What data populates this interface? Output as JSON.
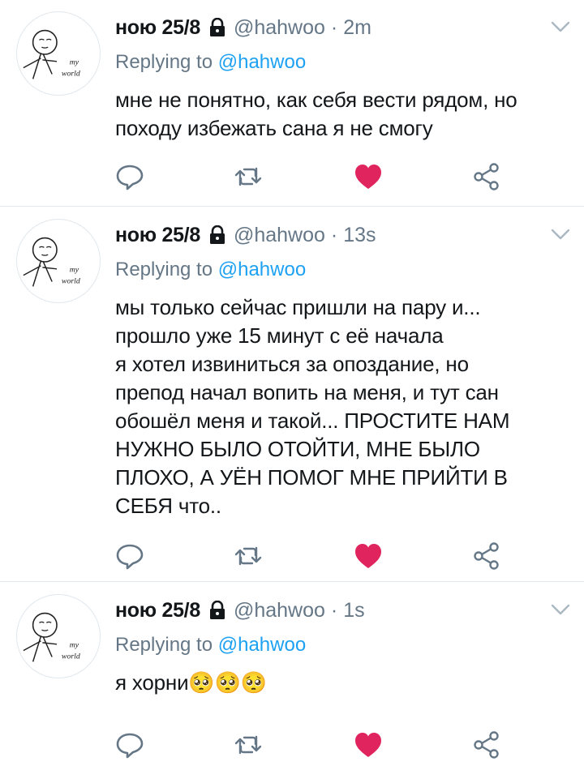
{
  "colors": {
    "text": "#14171a",
    "secondary": "#657786",
    "mention": "#1da1f2",
    "like": "#e0245e",
    "divider": "#e1e8ed"
  },
  "avatar": {
    "label_top": "my",
    "label_bottom": "world"
  },
  "tweets": [
    {
      "display_name": "ною 25/8",
      "handle": "@hahwoo",
      "dot": "·",
      "time": "2m",
      "replying_prefix": "Replying to ",
      "replying_mention": "@hahwoo",
      "text": "мне не понятно, как себя вести рядом, но\nпоходу избежать сана я не смогу",
      "icons": [
        "lock-icon",
        "chevron-down-icon",
        "reply-icon",
        "retweet-icon",
        "heart-icon",
        "share-icon"
      ],
      "liked": true
    },
    {
      "display_name": "ною 25/8",
      "handle": "@hahwoo",
      "dot": "·",
      "time": "13s",
      "replying_prefix": "Replying to ",
      "replying_mention": "@hahwoo",
      "text": "мы только сейчас пришли на пару и...\nпрошло уже 15 минут с её начала\nя хотел извиниться за опоздание, но\nпрепод начал вопить на меня, и тут сан\nобошёл меня и такой... ПРОСТИТЕ НАМ\nНУЖНО БЫЛО ОТОЙТИ, МНЕ БЫЛО\nПЛОХО, А УЁН ПОМОГ МНЕ ПРИЙТИ В\nСЕБЯ что..",
      "icons": [
        "lock-icon",
        "chevron-down-icon",
        "reply-icon",
        "retweet-icon",
        "heart-icon",
        "share-icon"
      ],
      "liked": true
    },
    {
      "display_name": "ною 25/8",
      "handle": "@hahwoo",
      "dot": "·",
      "time": "1s",
      "replying_prefix": "Replying to ",
      "replying_mention": "@hahwoo",
      "text": "я хорни🥺🥺🥺",
      "icons": [
        "lock-icon",
        "chevron-down-icon",
        "reply-icon",
        "retweet-icon",
        "heart-icon",
        "share-icon"
      ],
      "liked": true
    }
  ]
}
